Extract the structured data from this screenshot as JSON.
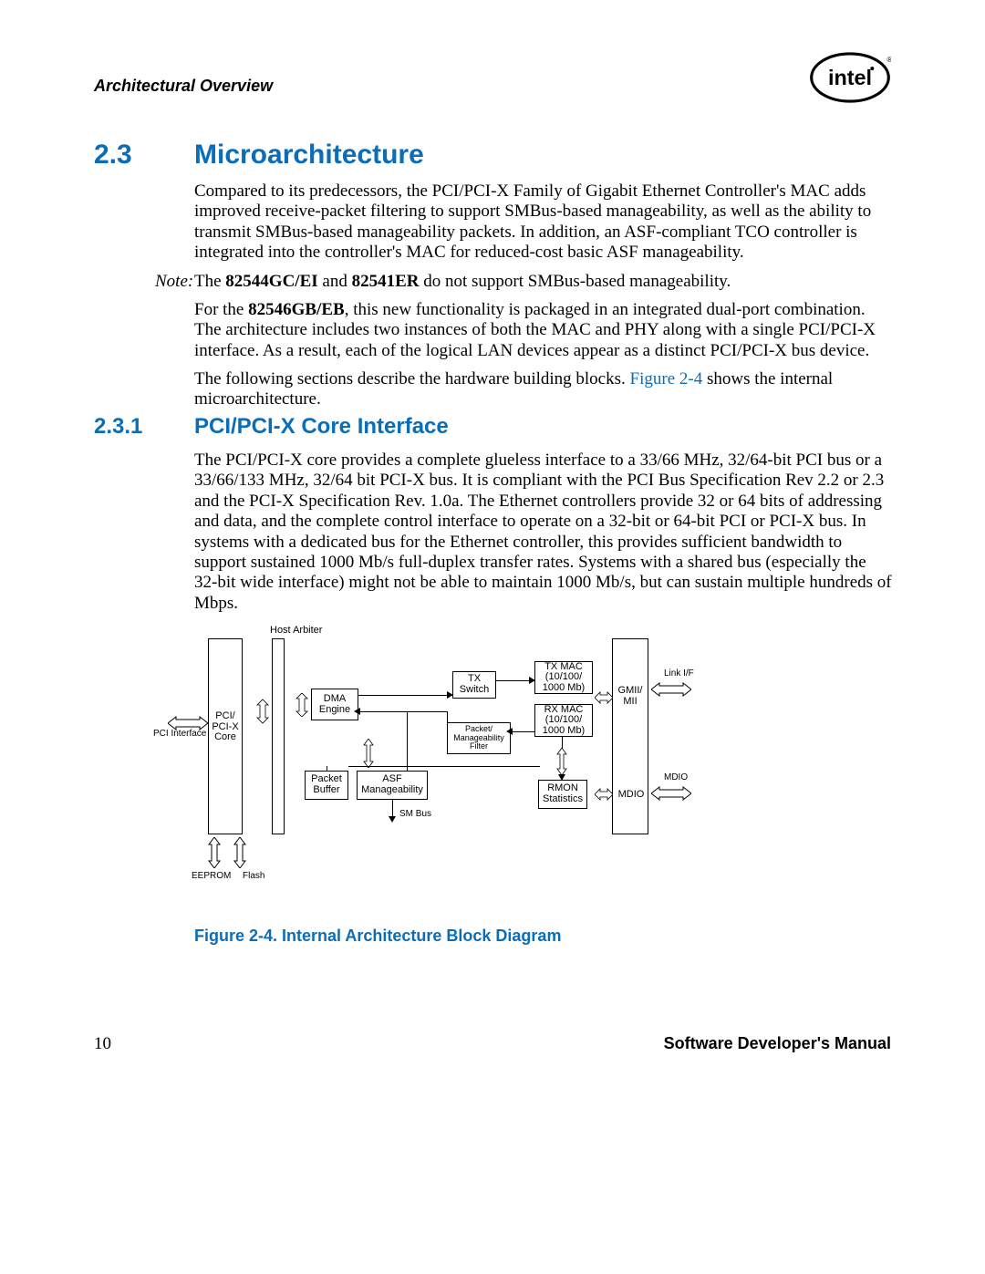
{
  "header": {
    "title": "Architectural Overview"
  },
  "section23": {
    "num": "2.3",
    "title": "Microarchitecture"
  },
  "para1": "Compared to its predecessors, the PCI/PCI-X Family of Gigabit Ethernet Controller's MAC adds improved receive-packet filtering to support SMBus-based manageability, as well as the ability to transmit SMBus-based manageability packets. In addition, an ASF-compliant TCO controller is integrated into the controller's MAC for reduced-cost basic ASF manageability.",
  "note": {
    "label": "Note:",
    "text_pre": "The ",
    "bold1": "82544GC/EI",
    "text_mid1": " and ",
    "bold2": "82541ER",
    "text_post": " do not support SMBus-based manageability."
  },
  "para2_pre": "For the ",
  "para2_bold": "82546GB/EB",
  "para2_post": ", this new functionality is packaged in an integrated dual-port combination. The architecture includes two instances of both the MAC and PHY along with a single PCI/PCI-X interface. As a result, each of the logical LAN devices appear as a distinct PCI/PCI-X bus device.",
  "para3_pre": "The following sections describe the hardware building blocks. ",
  "para3_link": "Figure 2-4",
  "para3_post": " shows the internal microarchitecture.",
  "section231": {
    "num": "2.3.1",
    "title": "PCI/PCI-X Core Interface"
  },
  "para4": "The PCI/PCI-X core provides a complete glueless interface to a 33/66 MHz, 32/64-bit PCI bus or a 33/66/133 MHz, 32/64 bit PCI-X bus. It is compliant with the PCI Bus Specification Rev 2.2 or 2.3 and the PCI-X Specification Rev. 1.0a. The Ethernet controllers provide 32 or 64 bits of addressing and data, and the complete control interface to operate on a 32-bit or 64-bit PCI or PCI-X bus. In systems with a dedicated bus for the Ethernet controller, this provides sufficient bandwidth to support sustained 1000 Mb/s full-duplex transfer rates. Systems with a shared bus (especially the 32-bit wide interface) might not be able to maintain 1000 Mb/s, but can sustain multiple hundreds of Mbps.",
  "figure": {
    "caption": "Figure 2-4. Internal Architecture Block Diagram"
  },
  "footer": {
    "page": "10",
    "manual": "Software Developer's Manual"
  },
  "diagram": {
    "pci_interface": "PCI Interface",
    "pci_core": "PCI/\nPCI-X\nCore",
    "host_arbiter": "Host Arbiter",
    "dma_engine": "DMA\nEngine",
    "packet_buffer": "Packet\nBuffer",
    "asf": "ASF\nManageability",
    "sm_bus": "SM Bus",
    "tx_switch": "TX\nSwitch",
    "pkt_filter": "Packet/\nManageability\nFilter",
    "tx_mac": "TX MAC\n(10/100/\n1000 Mb)",
    "rx_mac": "RX MAC\n(10/100/\n1000 Mb)",
    "rmon": "RMON\nStatistics",
    "gmii": "GMII/\nMII",
    "mdio": "MDIO",
    "mdio2": "MDIO",
    "link_if": "Link I/F",
    "eeprom": "EEPROM",
    "flash": "Flash"
  }
}
